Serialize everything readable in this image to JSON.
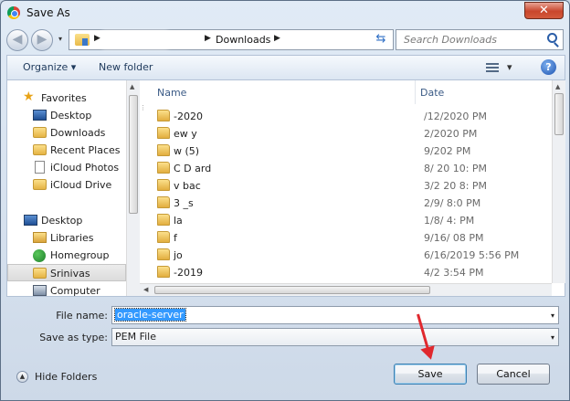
{
  "window": {
    "title": "Save As",
    "close_glyph": "✕"
  },
  "navigation": {
    "back_glyph": "◀",
    "forward_glyph": "▶",
    "drop_glyph": "▾",
    "breadcrumb_current": "Downloads",
    "crumb_sep": "▶",
    "refresh_glyph": "⇆",
    "search_placeholder": "Search Downloads"
  },
  "toolbar": {
    "organize_label": "Organize ▾",
    "new_folder_label": "New folder",
    "view_drop": "▾",
    "help_glyph": "?"
  },
  "sidebar": {
    "items": [
      {
        "label": "Favorites",
        "icon": "star-icon"
      },
      {
        "label": "Desktop",
        "icon": "desktop-icon"
      },
      {
        "label": "Downloads",
        "icon": "folder-icon"
      },
      {
        "label": "Recent Places",
        "icon": "folder-icon"
      },
      {
        "label": "iCloud Photos",
        "icon": "document-icon"
      },
      {
        "label": "iCloud Drive",
        "icon": "folder-icon"
      },
      {
        "label": "Desktop",
        "icon": "desktop-icon"
      },
      {
        "label": "Libraries",
        "icon": "library-icon"
      },
      {
        "label": "Homegroup",
        "icon": "homegroup-icon"
      },
      {
        "label": "Srinivas",
        "icon": "user-folder-icon"
      },
      {
        "label": "Computer",
        "icon": "computer-icon"
      }
    ]
  },
  "file_list": {
    "columns": {
      "name": "Name",
      "date": "Date"
    },
    "rows": [
      {
        "name": "-2020",
        "date": "/12/2020   PM"
      },
      {
        "name": "ew   y",
        "date": "2/2020   PM"
      },
      {
        "name": "w   (5)",
        "date": "9/202  PM"
      },
      {
        "name": "C  D   ard",
        "date": "8/  20  10:   PM"
      },
      {
        "name": "v  bac",
        "date": "3/2  20 8:  PM"
      },
      {
        "name": "3    _s",
        "date": "2/9/   8:0   PM"
      },
      {
        "name": "la",
        "date": "1/8/  4:  PM"
      },
      {
        "name": "f",
        "date": "9/16/  08 PM"
      },
      {
        "name": "jo",
        "date": "6/16/2019 5:56 PM"
      },
      {
        "name": "    -2019",
        "date": "4/2   3:54 PM"
      }
    ]
  },
  "form": {
    "file_name_label": "File name:",
    "file_name_value": "oracle-server",
    "save_type_label": "Save as type:",
    "save_type_value": "PEM File",
    "drop_glyph": "▾"
  },
  "footer": {
    "hide_folders_label": "Hide Folders",
    "hide_glyph": "▲",
    "save_label": "Save",
    "cancel_label": "Cancel"
  },
  "colors": {
    "annotation_arrow": "#e0282e",
    "selection": "#3399ff"
  }
}
